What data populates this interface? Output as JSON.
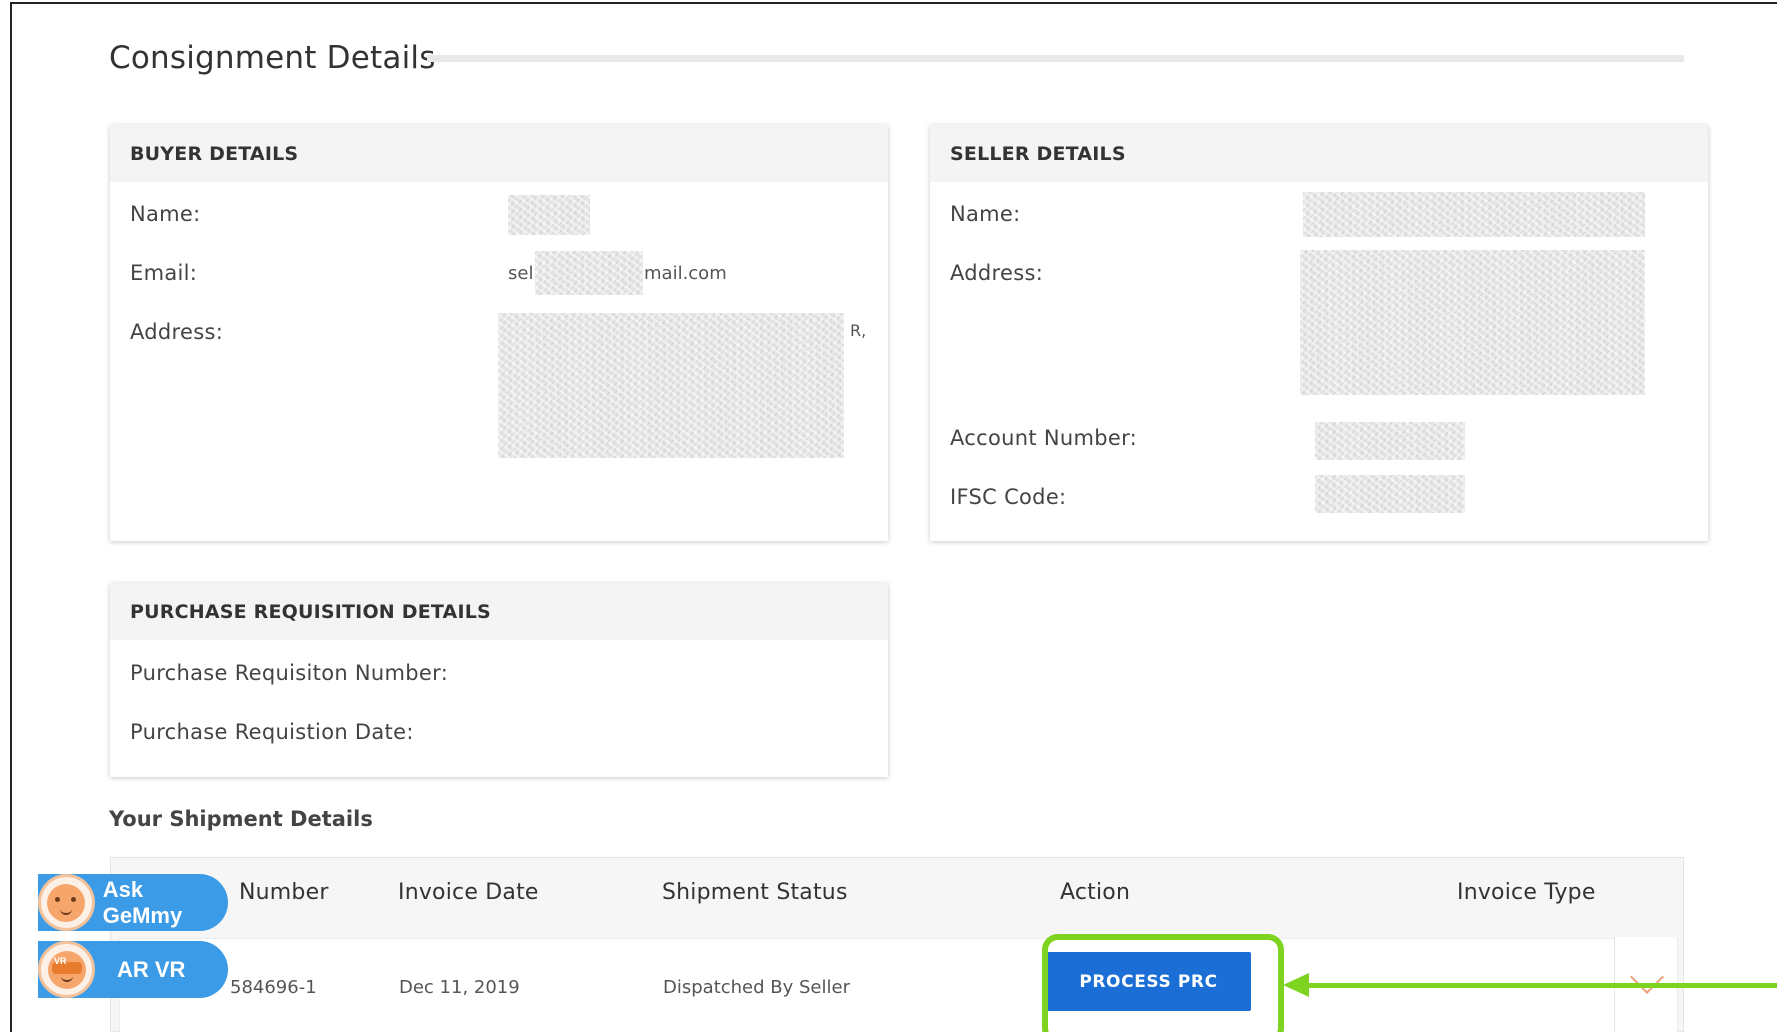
{
  "page": {
    "title": "Consignment Details"
  },
  "buyer": {
    "heading": "BUYER DETAILS",
    "name_label": "Name:",
    "email_label": "Email:",
    "email_prefix": "sel",
    "email_suffix": "mail.com",
    "address_label": "Address:",
    "address_tail": "R,"
  },
  "seller": {
    "heading": "SELLER DETAILS",
    "name_label": "Name:",
    "address_label": "Address:",
    "account_label": "Account Number:",
    "ifsc_label": "IFSC Code:"
  },
  "requisition": {
    "heading": "PURCHASE REQUISITION DETAILS",
    "number_label": "Purchase Requisiton Number:",
    "date_label": "Purchase Requistion Date:"
  },
  "shipment": {
    "heading": "Your Shipment Details",
    "columns": [
      "Number",
      "Invoice Date",
      "Shipment Status",
      "Action",
      "Invoice Type"
    ],
    "rows": [
      {
        "number": "584696-1",
        "invoice_date": "Dec 11, 2019",
        "status": "Dispatched By Seller",
        "action": "PROCESS PRC",
        "invoice_type": ""
      }
    ]
  },
  "floating": {
    "ask_label": "Ask GeMmy",
    "vr_label": "AR VR",
    "vr_tag": "VR"
  },
  "colors": {
    "primary_button": "#1b6ed6",
    "highlight": "#7ed321",
    "float_button": "#3b9be6"
  }
}
